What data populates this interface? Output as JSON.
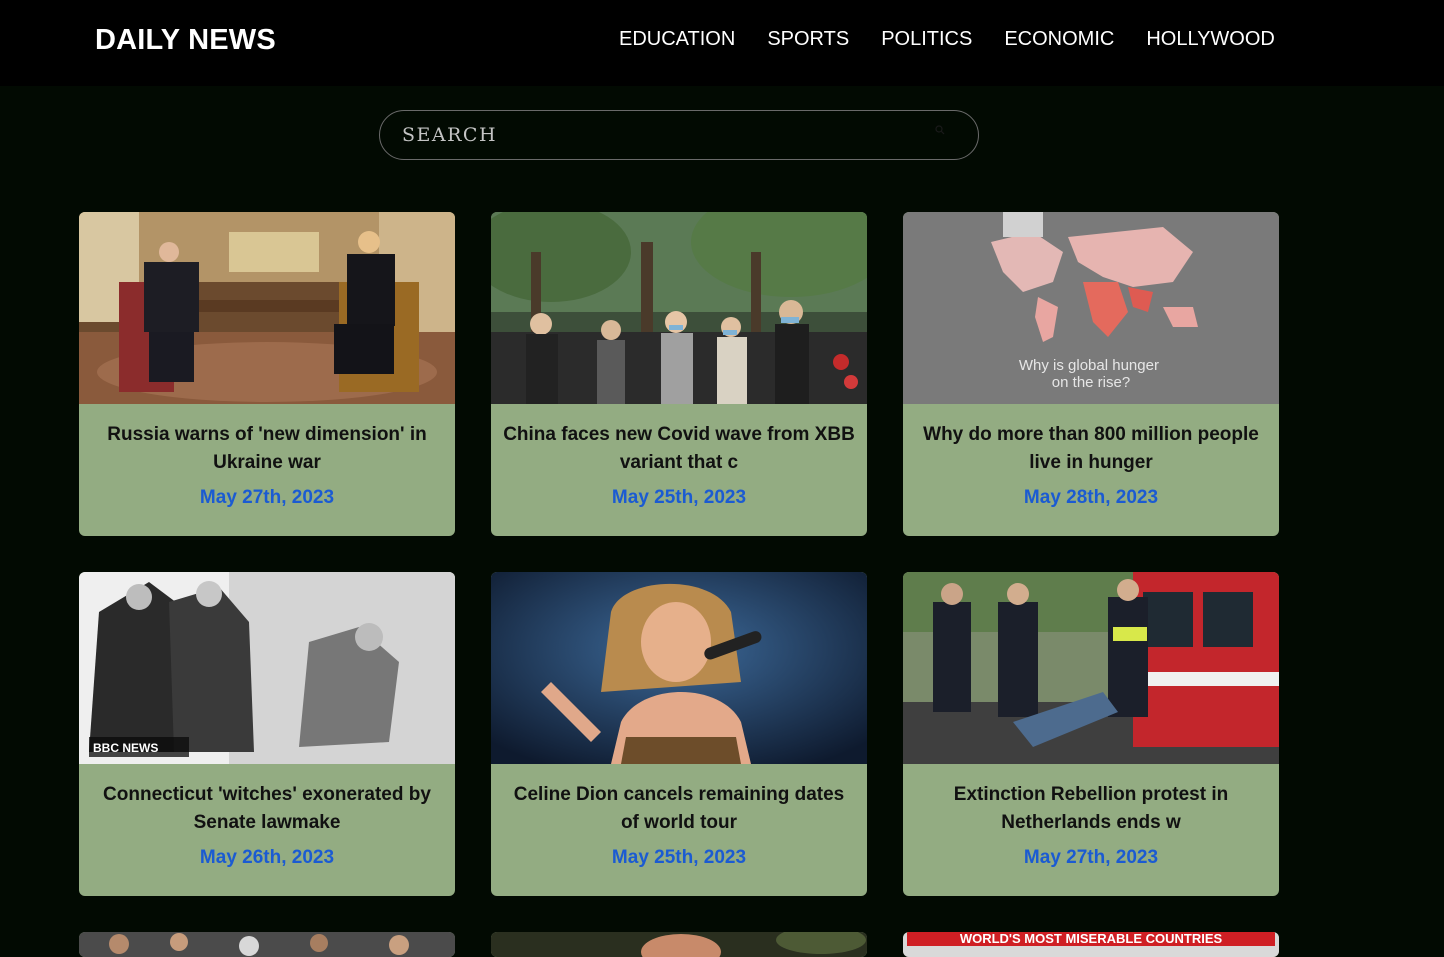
{
  "header": {
    "brand": "DAILY NEWS",
    "nav": [
      "EDUCATION",
      "SPORTS",
      "POLITICS",
      "ECONOMIC",
      "HOLLYWOOD"
    ]
  },
  "search": {
    "placeholder": "SEARCH"
  },
  "articles": [
    {
      "title": "Russia warns of 'new dimension' in Ukraine war",
      "date": "May 27th, 2023"
    },
    {
      "title": "China faces new Covid wave from XBB variant that c",
      "date": "May 25th, 2023"
    },
    {
      "title": "Why do more than 800 million people live in hunger",
      "date": "May 28th, 2023",
      "image_caption": "Why is global hunger on the rise?"
    },
    {
      "title": "Connecticut 'witches' exonerated by Senate lawmake",
      "date": "May 26th, 2023",
      "image_logo": "BBC NEWS"
    },
    {
      "title": "Celine Dion cancels remaining dates of world tour",
      "date": "May 25th, 2023"
    },
    {
      "title": "Extinction Rebellion protest in Netherlands ends w",
      "date": "May 27th, 2023"
    }
  ],
  "partial_articles": [
    {
      "image_caption": ""
    },
    {
      "image_caption": ""
    },
    {
      "image_caption": "WORLD'S MOST MISERABLE COUNTRIES"
    }
  ],
  "colors": {
    "page_bg": "#020a02",
    "navbar_bg": "#000000",
    "card_bg": "#93ac82",
    "date_text": "#1b5bd2"
  }
}
